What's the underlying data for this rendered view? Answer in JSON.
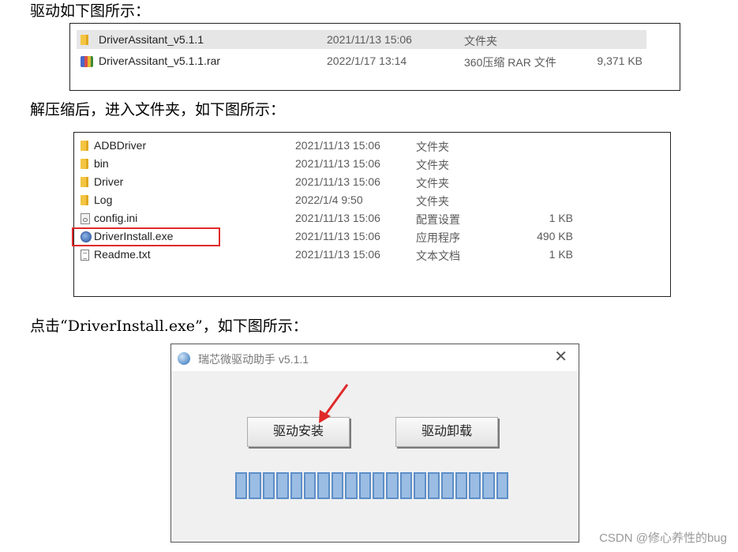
{
  "paragraphs": {
    "p1": "驱动如下图所示：",
    "p2": "解压缩后，进入文件夹，如下图所示：",
    "p3": "点击“DriverInstall.exe”，如下图所示："
  },
  "listing1": [
    {
      "name": "DriverAssitant_v5.1.1",
      "date": "2021/11/13 15:06",
      "type": "文件夹",
      "size": "",
      "icon": "folder-icon"
    },
    {
      "name": "DriverAssitant_v5.1.1.rar",
      "date": "2022/1/17 13:14",
      "type": "360压缩 RAR 文件",
      "size": "9,371 KB",
      "icon": "rar-archive-icon"
    }
  ],
  "listing2": [
    {
      "name": "ADBDriver",
      "date": "2021/11/13 15:06",
      "type": "文件夹",
      "size": "",
      "icon": "folder-icon"
    },
    {
      "name": "bin",
      "date": "2021/11/13 15:06",
      "type": "文件夹",
      "size": "",
      "icon": "folder-icon"
    },
    {
      "name": "Driver",
      "date": "2021/11/13 15:06",
      "type": "文件夹",
      "size": "",
      "icon": "folder-icon"
    },
    {
      "name": "Log",
      "date": "2022/1/4 9:50",
      "type": "文件夹",
      "size": "",
      "icon": "folder-icon"
    },
    {
      "name": "config.ini",
      "date": "2021/11/13 15:06",
      "type": "配置设置",
      "size": "1 KB",
      "icon": "config-file-icon"
    },
    {
      "name": "DriverInstall.exe",
      "date": "2021/11/13 15:06",
      "type": "应用程序",
      "size": "490 KB",
      "icon": "exe-icon"
    },
    {
      "name": "Readme.txt",
      "date": "2021/11/13 15:06",
      "type": "文本文档",
      "size": "1 KB",
      "icon": "text-file-icon"
    }
  ],
  "dialog": {
    "title": "瑞芯微驱动助手 v5.1.1",
    "close_glyph": "✕",
    "install_label": "驱动安装",
    "uninstall_label": "驱动卸载",
    "progress_segments": 20
  },
  "watermark": "CSDN @修心养性的bug",
  "colors": {
    "highlight": "#e02a2a",
    "arrow": "#e02a2a",
    "progress": "#9bbde3"
  }
}
